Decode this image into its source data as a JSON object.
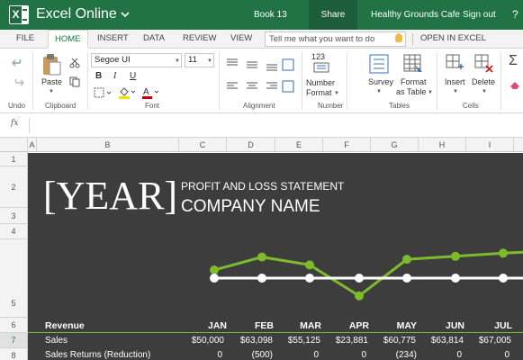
{
  "app": {
    "name": "Excel Online",
    "workbook": "Book 13",
    "share_label": "Share",
    "user": "Healthy Grounds Cafe",
    "signout_label": "Sign out",
    "help_label": "?",
    "accent": "#217346"
  },
  "tabs": [
    {
      "label": "FILE"
    },
    {
      "label": "HOME"
    },
    {
      "label": "INSERT"
    },
    {
      "label": "DATA"
    },
    {
      "label": "REVIEW"
    },
    {
      "label": "VIEW"
    }
  ],
  "tell_me": "Tell me what you want to do",
  "open_in_excel": "OPEN IN EXCEL",
  "ribbon": {
    "undo_group": "Undo",
    "clipboard_group": "Clipboard",
    "paste_label": "Paste",
    "font_group": "Font",
    "font_name": "Segoe UI",
    "font_size": "11",
    "bold": "B",
    "italic": "I",
    "underline": "U",
    "alignment_group": "Alignment",
    "number_group": "Number",
    "number_format_1": "Number",
    "number_format_2": "Format",
    "number_icon_text": "123",
    "tables_group": "Tables",
    "survey_label": "Survey",
    "format_table_1": "Format",
    "format_table_2": "as Table",
    "cells_group": "Cells",
    "insert_label": "Insert",
    "delete_label": "Delete",
    "sum_glyph": "Σ"
  },
  "formula_bar": {
    "fx": "fx",
    "value": ""
  },
  "columns": [
    "A",
    "B",
    "C",
    "D",
    "E",
    "F",
    "G",
    "H",
    "I"
  ],
  "rows": [
    "1",
    "2",
    "3",
    "4",
    "5",
    "6",
    "7",
    "8"
  ],
  "sheet": {
    "year": "[YEAR]",
    "statement_title": "PROFIT AND LOSS STATEMENT",
    "company": "COMPANY NAME",
    "revenue_label": "Revenue",
    "months": [
      "JAN",
      "FEB",
      "MAR",
      "APR",
      "MAY",
      "JUN",
      "JUL"
    ],
    "sales_label": "Sales",
    "sales": [
      "$50,000",
      "$63,098",
      "$55,125",
      "$23,881",
      "$60,775",
      "$63,814",
      "$67,005"
    ],
    "returns_label": "Sales Returns (Reduction)",
    "returns": [
      "0",
      "(500)",
      "0",
      "0",
      "(234)",
      "0",
      "0"
    ]
  },
  "chart_data": {
    "type": "line",
    "categories": [
      "JAN",
      "FEB",
      "MAR",
      "APR",
      "MAY",
      "JUN",
      "JUL"
    ],
    "series": [
      {
        "values": [
          50000,
          63098,
          55125,
          23881,
          60775,
          63814,
          67005
        ],
        "color": "#7dbb2d"
      },
      {
        "values": [
          0,
          0,
          0,
          0,
          0,
          0,
          0
        ],
        "color": "#ffffff"
      }
    ],
    "legend": "none",
    "grid": false
  }
}
